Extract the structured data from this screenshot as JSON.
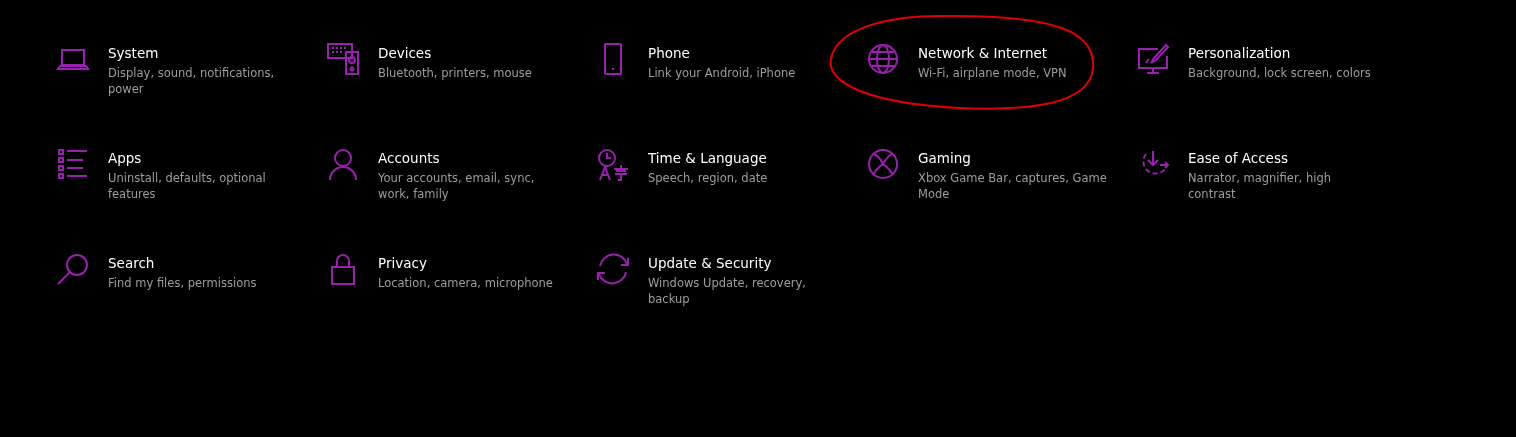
{
  "settings": [
    {
      "kind": "system",
      "title": "System",
      "description": [
        "Display, sound, notifications,",
        "power"
      ],
      "circled": false
    },
    {
      "kind": "devices",
      "title": "Devices",
      "description": [
        "Bluetooth, printers, mouse"
      ],
      "circled": false
    },
    {
      "kind": "phone",
      "title": "Phone",
      "description": [
        "Link your Android, iPhone"
      ],
      "circled": false
    },
    {
      "kind": "network",
      "title": "Network & Internet",
      "description": [
        "Wi-Fi, airplane mode, VPN"
      ],
      "circled": true
    },
    {
      "kind": "personalization",
      "title": "Personalization",
      "description": [
        "Background, lock screen, colors"
      ],
      "circled": false
    },
    {
      "kind": "apps",
      "title": "Apps",
      "description": [
        "Uninstall, defaults, optional",
        "features"
      ],
      "circled": false
    },
    {
      "kind": "accounts",
      "title": "Accounts",
      "description": [
        "Your accounts, email, sync,",
        "work, family"
      ],
      "circled": false
    },
    {
      "kind": "time",
      "title": "Time & Language",
      "description": [
        "Speech, region, date"
      ],
      "circled": false
    },
    {
      "kind": "gaming",
      "title": "Gaming",
      "description": [
        "Xbox Game Bar, captures, Game",
        "Mode"
      ],
      "circled": false
    },
    {
      "kind": "ease",
      "title": "Ease of Access",
      "description": [
        "Narrator, magnifier, high",
        "contrast"
      ],
      "circled": false
    },
    {
      "kind": "search",
      "title": "Search",
      "description": [
        "Find my files, permissions"
      ],
      "circled": false
    },
    {
      "kind": "privacy",
      "title": "Privacy",
      "description": [
        "Location, camera, microphone"
      ],
      "circled": false
    },
    {
      "kind": "update",
      "title": "Update & Security",
      "description": [
        "Windows Update, recovery,",
        "backup"
      ],
      "circled": false
    }
  ]
}
